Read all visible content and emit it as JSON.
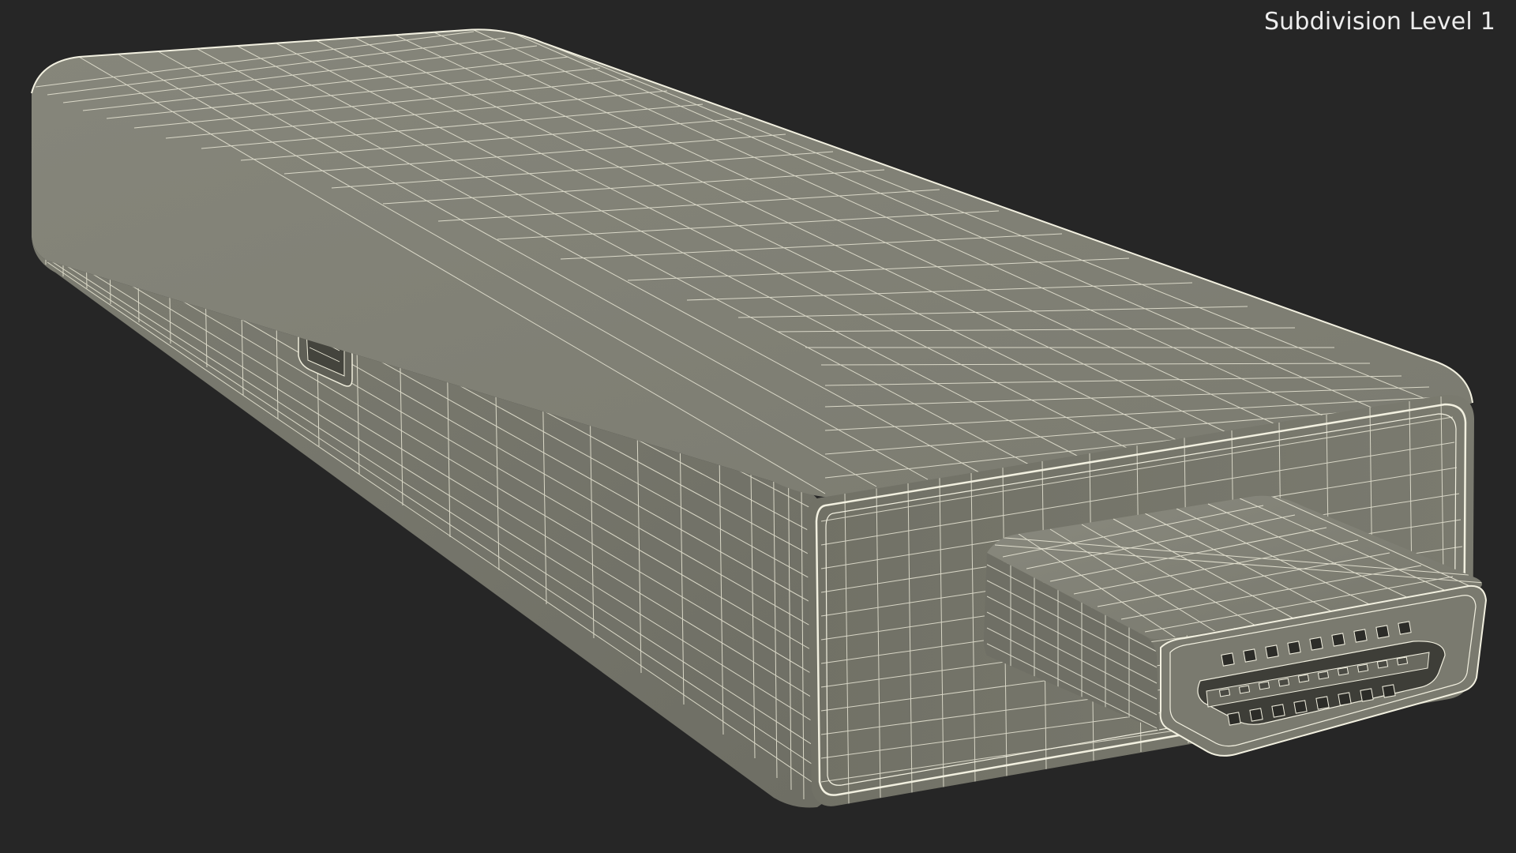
{
  "viewport": {
    "subdivision_label": "Subdivision Level 1"
  },
  "model": {
    "name": "hdmi-stick-dongle",
    "render_mode": "wireframe-on-shaded",
    "body_color": "#7d7d72",
    "wire_color": "#e9e7d6",
    "background_color": "#262626"
  }
}
